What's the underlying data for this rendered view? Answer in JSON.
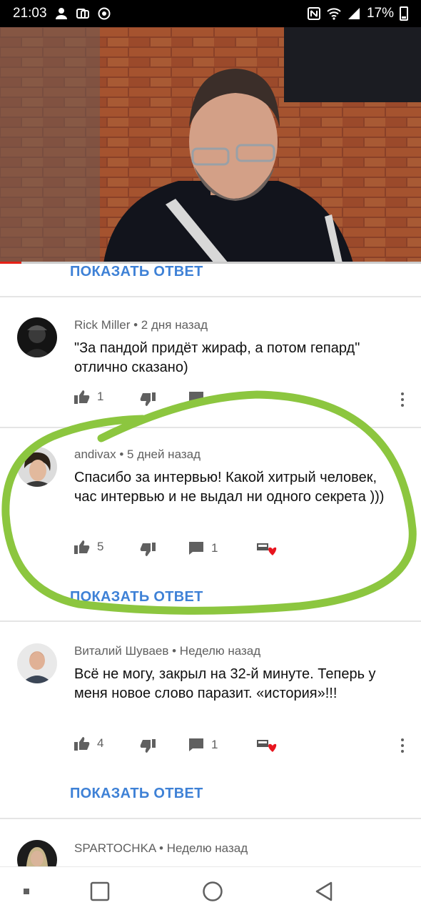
{
  "status_bar": {
    "time": "21:03",
    "battery": "17%"
  },
  "video": {
    "progress_fraction": 0.05
  },
  "show_reply_label": "ПОКАЗАТЬ ОТВЕТ",
  "comments": [
    {
      "author": "Rick Miller",
      "age": "2 дня назад",
      "text": "\"За пандой придёт жираф, а потом гепард\" отлично сказано)",
      "likes": "1"
    },
    {
      "author": "andivax",
      "age": "5 дней назад",
      "text": "Спасибо за интервью! Какой хитрый человек, час интервью и не выдал ни одного секрета )))",
      "likes": "5",
      "replies": "1"
    },
    {
      "author": "Виталий Шуваев",
      "age": "Неделю назад",
      "text": "Всё не могу, закрыл на 32-й минуте. Теперь у меня новое слово паразит. «история»!!!",
      "likes": "4",
      "replies": "1"
    },
    {
      "author": "SPARTOCHKA",
      "age": "Неделю назад"
    }
  ],
  "colors": {
    "link": "#3e81d6",
    "annotation": "#8cc63f",
    "heart": "#e8141e",
    "progress": "#e62117"
  }
}
